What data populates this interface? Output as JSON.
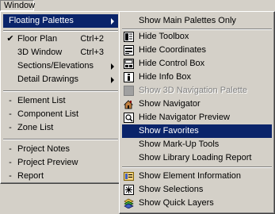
{
  "menubar": {
    "title": "Window"
  },
  "left_menu": {
    "items": [
      {
        "label": "Floating Palettes",
        "submenu": true,
        "highlighted": true
      },
      {
        "label": "Floor Plan",
        "shortcut": "Ctrl+2",
        "checked": true
      },
      {
        "label": "3D Window",
        "shortcut": "Ctrl+3"
      },
      {
        "label": "Sections/Elevations",
        "submenu": true
      },
      {
        "label": "Detail Drawings",
        "submenu": true
      },
      {
        "label": "Element List",
        "bullet": "-"
      },
      {
        "label": "Component List",
        "bullet": "-"
      },
      {
        "label": "Zone List",
        "bullet": "-"
      },
      {
        "label": "Project Notes",
        "bullet": "-"
      },
      {
        "label": "Project Preview",
        "bullet": "-"
      },
      {
        "label": "Report",
        "bullet": "-"
      }
    ],
    "check_glyph": "✔"
  },
  "right_menu": {
    "items": [
      {
        "label": "Show Main Palettes Only"
      },
      {
        "label": "Hide Toolbox",
        "icon": "toolbox-icon"
      },
      {
        "label": "Hide Coordinates",
        "icon": "coordinates-icon"
      },
      {
        "label": "Hide Control Box",
        "icon": "control-box-icon"
      },
      {
        "label": "Hide Info Box",
        "icon": "info-box-icon"
      },
      {
        "label": "Show 3D Navigation Palette",
        "disabled": true,
        "icon": "3d-navigation-icon"
      },
      {
        "label": "Show Navigator",
        "icon": "navigator-icon"
      },
      {
        "label": "Hide Navigator Preview",
        "icon": "navigator-preview-icon"
      },
      {
        "label": "Show Favorites",
        "highlighted": true
      },
      {
        "label": "Show Mark-Up Tools"
      },
      {
        "label": "Show Library Loading Report"
      },
      {
        "label": "Show Element Information",
        "icon": "element-info-icon"
      },
      {
        "label": "Show Selections",
        "icon": "selections-icon"
      },
      {
        "label": "Show Quick Layers",
        "icon": "quick-layers-icon"
      }
    ]
  },
  "colors": {
    "highlight": "#0a246a",
    "menu_bg": "#d4d0c8"
  }
}
